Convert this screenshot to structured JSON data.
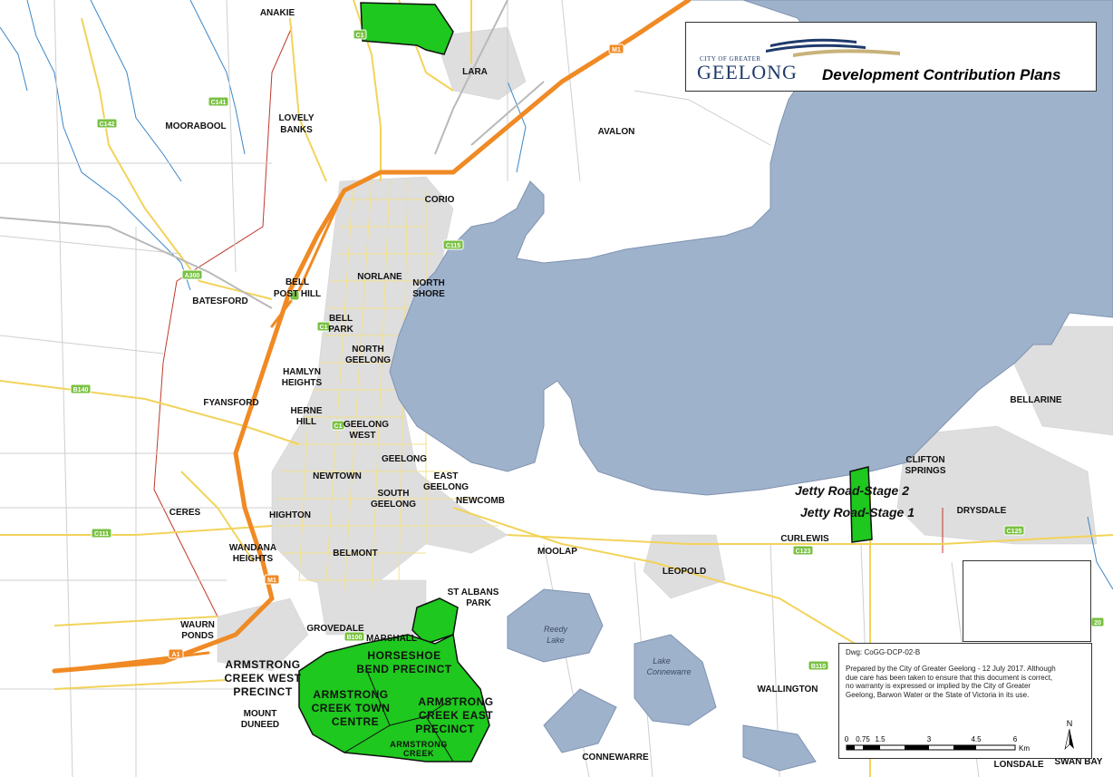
{
  "header": {
    "logo_small": "CITY OF GREATER",
    "logo_big": "GEELONG",
    "title": "Development Contribution Plans"
  },
  "info": {
    "dwg": "Dwg: CoGG-DCP-02-B",
    "prepared": "Prepared by the City of Greater Geelong - 12 July 2017. Although due care has been taken to ensure that this document is correct, no warranty is expressed or implied by the City of Greater Geelong, Barwon Water or the State of Victoria in its use."
  },
  "scale": {
    "ticks": [
      "0",
      "0.75",
      "1.5",
      "3",
      "4.5",
      "6"
    ],
    "unit": "Km"
  },
  "north_label": "N",
  "places": {
    "anakie": "ANAKIE",
    "lara": "LARA",
    "avalon": "AVALON",
    "moorabool": "MOORABOOL",
    "lovely1": "LOVELY",
    "lovely2": "BANKS",
    "corio": "CORIO",
    "norlane": "NORLANE",
    "north_shore1": "NORTH",
    "north_shore2": "SHORE",
    "bell_post1": "BELL",
    "bell_post2": "POST HILL",
    "batesford": "BATESFORD",
    "bell_park1": "BELL",
    "bell_park2": "PARK",
    "north_geelong1": "NORTH",
    "north_geelong2": "GEELONG",
    "hamlyn1": "HAMLYN",
    "hamlyn2": "HEIGHTS",
    "fyansford": "FYANSFORD",
    "herne1": "HERNE",
    "herne2": "HILL",
    "geelong_west1": "GEELONG",
    "geelong_west2": "WEST",
    "geelong": "GEELONG",
    "newtown": "NEWTOWN",
    "east_geelong1": "EAST",
    "east_geelong2": "GEELONG",
    "south_geelong1": "SOUTH",
    "south_geelong2": "GEELONG",
    "newcomb": "NEWCOMB",
    "ceres": "CERES",
    "highton": "HIGHTON",
    "wandana1": "WANDANA",
    "wandana2": "HEIGHTS",
    "belmont": "BELMONT",
    "moolap": "MOOLAP",
    "leopold": "LEOPOLD",
    "curlewis": "CURLEWIS",
    "drysdale": "DRYSDALE",
    "clifton1": "CLIFTON",
    "clifton2": "SPRINGS",
    "bellarine": "BELLARINE",
    "st_albans1": "ST ALBANS",
    "st_albans2": "PARK",
    "waurn1": "WAURN",
    "waurn2": "PONDS",
    "grovedale": "GROVEDALE",
    "marshall": "MARSHALL",
    "mount1": "MOUNT",
    "mount2": "DUNEED",
    "wallington": "WALLINGTON",
    "connewarre": "CONNEWARRE",
    "lonsdale": "LONSDALE",
    "swan_bay": "SWAN BAY",
    "reedy1": "Reedy",
    "reedy2": "Lake",
    "lake_conn1": "Lake",
    "lake_conn2": "Connewarre"
  },
  "precincts": {
    "horseshoe1": "HORSESHOE",
    "horseshoe2": "BEND PRECINCT",
    "acw1": "ARMSTRONG",
    "acw2": "CREEK WEST",
    "acw3": "PRECINCT",
    "act1": "ARMSTRONG",
    "act2": "CREEK TOWN",
    "act3": "CENTRE",
    "ace1": "ARMSTRONG",
    "ace2": "CREEK EAST",
    "ace3": "PRECINCT",
    "ac1": "ARMSTRONG",
    "ac2": "CREEK",
    "jetty2": "Jetty Road-Stage 2",
    "jetty1": "Jetty Road-Stage 1"
  },
  "roads": {
    "m1_a": "M1",
    "m1_b": "M1",
    "a1": "A1",
    "a300": "A300",
    "c141": "C141",
    "c142": "C142",
    "c115": "C115",
    "c111": "C111",
    "c123": "C123",
    "c125": "C125",
    "b110": "B110",
    "b140": "B140",
    "b100": "B100",
    "c1a": "C1",
    "c1b": "C1",
    "c1c": "C1",
    "r20": "20"
  },
  "colors": {
    "water": "#9fb2cc",
    "precinct": "#1ec81e",
    "highway": "#f08a24",
    "road": "#f2d35a",
    "urban": "#d9d9d9",
    "boundary": "#c0392b",
    "stream": "#3a86c8"
  }
}
